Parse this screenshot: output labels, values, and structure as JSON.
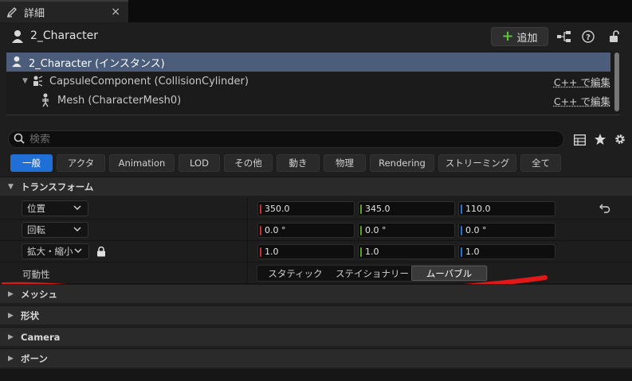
{
  "tab": {
    "title": "詳細",
    "close": "×"
  },
  "header": {
    "actor_name": "2_Character",
    "add_label": "追加"
  },
  "tree": {
    "rows": [
      {
        "label": "2_Character (インスタンス)"
      },
      {
        "label": "CapsuleComponent (CollisionCylinder)",
        "action": "C++ で編集"
      },
      {
        "label": "Mesh (CharacterMesh0)",
        "action": "C++ で編集"
      }
    ]
  },
  "search": {
    "placeholder": "検索",
    "value": ""
  },
  "filters": [
    "一般",
    "アクタ",
    "Animation",
    "LOD",
    "その他",
    "動き",
    "物理",
    "Rendering",
    "ストリーミング",
    "全て"
  ],
  "transform": {
    "title": "トランスフォーム",
    "location": {
      "label": "位置",
      "x": "350.0",
      "y": "345.0",
      "z": "110.0"
    },
    "rotation": {
      "label": "回転",
      "x": "0.0 °",
      "y": "0.0 °",
      "z": "0.0 °"
    },
    "scale": {
      "label": "拡大・縮小",
      "x": "1.0",
      "y": "1.0",
      "z": "1.0"
    },
    "mobility": {
      "label": "可動性",
      "options": [
        "スタティック",
        "ステイショナリー",
        "ムーバブル"
      ],
      "selected": "ムーバブル"
    }
  },
  "categories": [
    "メッシュ",
    "形状",
    "Camera",
    "ボーン"
  ],
  "colors": {
    "accent": "#1f6fd6",
    "selected_row": "#4b5d7a",
    "x_axis": "#c83232",
    "y_axis": "#5aa02c",
    "z_axis": "#2f6fd0",
    "annotation": "#e01818"
  }
}
